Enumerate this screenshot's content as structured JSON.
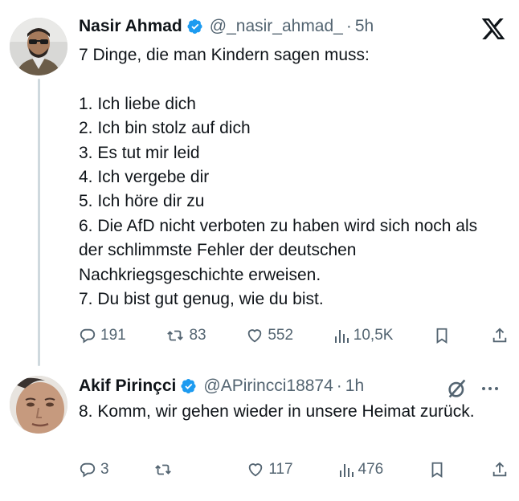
{
  "post": {
    "author": {
      "name": "Nasir Ahmad",
      "handle": "@_nasir_ahmad_",
      "time": "5h",
      "verified": true
    },
    "text": "7 Dinge, die man Kindern sagen muss:\n\n1. Ich liebe dich\n2. Ich bin stolz auf dich\n3. Es tut mir leid\n4. Ich vergebe dir\n5. Ich höre dir zu\n6. Die AfD nicht verboten zu haben wird sich noch als der schlimmste Fehler der deutschen Nachkriegsgeschichte erweisen.\n7. Du bist gut genug, wie du bist.",
    "stats": {
      "replies": "191",
      "reposts": "83",
      "likes": "552",
      "views": "10,5K"
    }
  },
  "reply": {
    "author": {
      "name": "Akif Pirinçci",
      "handle": "@APirincci18874",
      "time": "1h",
      "verified": true
    },
    "text": "8. Komm, wir gehen wieder in unsere Heimat zurück.",
    "stats": {
      "replies": "3",
      "reposts": "",
      "likes": "117",
      "views": "476"
    }
  },
  "separator": "·",
  "icons": {
    "platform_logo": "x-logo-icon",
    "verified": "verified-badge-icon",
    "grok": "grok-icon",
    "more": "more-icon",
    "reply": "reply-icon",
    "repost": "repost-icon",
    "like": "heart-icon",
    "views": "views-icon",
    "bookmark": "bookmark-icon",
    "share": "share-icon"
  },
  "colors": {
    "text": "#0f1419",
    "secondary": "#536471",
    "verified": "#1d9bf0",
    "thread_line": "#cfd9de"
  }
}
